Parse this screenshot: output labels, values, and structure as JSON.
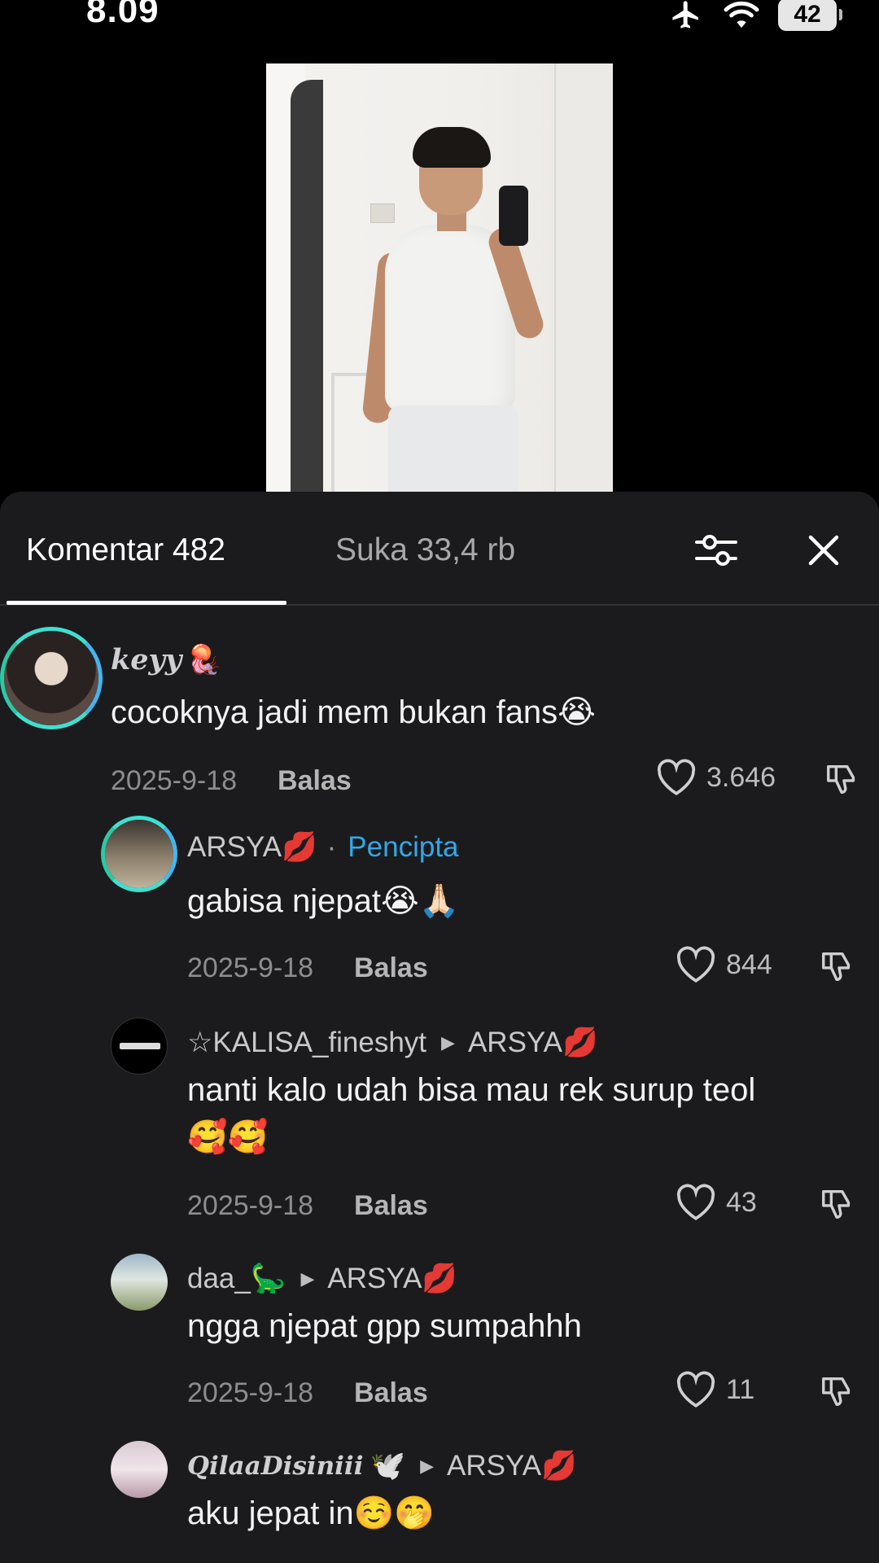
{
  "status_bar": {
    "time": "8.09",
    "battery": "42"
  },
  "tabs": {
    "comments": "Komentar 482",
    "likes": "Suka 33,4 rb"
  },
  "comments": [
    {
      "username": "keyy",
      "username_emoji": "🪼",
      "text": "cocoknya jadi mem bukan fans😭",
      "date": "2025-9-18",
      "reply": "Balas",
      "likes": "3.646"
    },
    {
      "username": "ARSYA💋",
      "creator_sep": "·",
      "creator_label": "Pencipta",
      "text": "gabisa njepat😭🙏🏻",
      "date": "2025-9-18",
      "reply": "Balas",
      "likes": "844"
    },
    {
      "username": "☆KALISA_fineshyt",
      "reply_to": "ARSYA💋",
      "text_line1": "nanti kalo udah bisa mau rek surup teol",
      "text_line2": "🥰🥰",
      "date": "2025-9-18",
      "reply": "Balas",
      "likes": "43"
    },
    {
      "username": "daa_🦕",
      "reply_to": "ARSYA💋",
      "text": "ngga njepat gpp sumpahhh",
      "date": "2025-9-18",
      "reply": "Balas",
      "likes": "11"
    },
    {
      "username": "QilaaDisiniii",
      "username_emoji": "🕊️",
      "reply_to": "ARSYA💋",
      "text": "aku jepat in☺️🤭"
    }
  ],
  "icons": {
    "airplane": "airplane-icon",
    "wifi": "wifi-icon",
    "filter": "sliders-icon",
    "close": "close-icon",
    "heart": "heart-icon",
    "dislike": "thumbs-down-icon"
  },
  "colors": {
    "sheet_bg": "#1b1b1d",
    "creator_label": "#31a8e8",
    "avatar_ring": "#3fe0d0"
  }
}
